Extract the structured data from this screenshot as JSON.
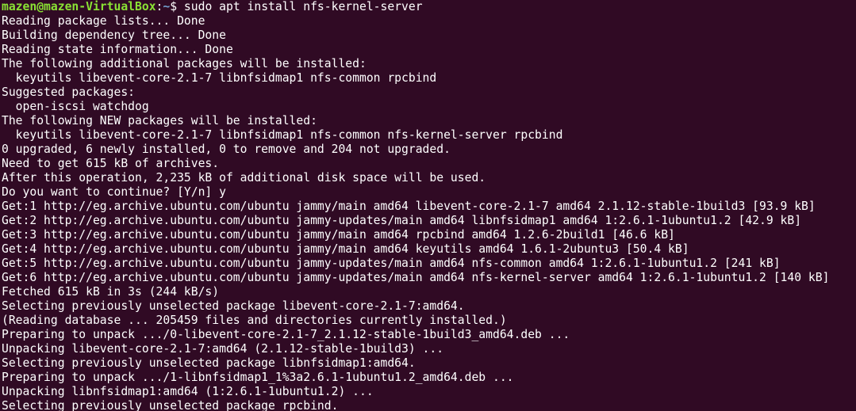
{
  "colors": {
    "background": "#300a24",
    "text": "#ffffff",
    "prompt_user": "#8ae234",
    "prompt_path": "#729fcf"
  },
  "prompt": {
    "user_host": "mazen@mazen-VirtualBox",
    "separator": ":",
    "path": "~",
    "symbol": "$ ",
    "command": "sudo apt install nfs-kernel-server"
  },
  "output_lines": [
    "Reading package lists... Done",
    "Building dependency tree... Done",
    "Reading state information... Done",
    "The following additional packages will be installed:",
    "  keyutils libevent-core-2.1-7 libnfsidmap1 nfs-common rpcbind",
    "Suggested packages:",
    "  open-iscsi watchdog",
    "The following NEW packages will be installed:",
    "  keyutils libevent-core-2.1-7 libnfsidmap1 nfs-common nfs-kernel-server rpcbind",
    "0 upgraded, 6 newly installed, 0 to remove and 204 not upgraded.",
    "Need to get 615 kB of archives.",
    "After this operation, 2,235 kB of additional disk space will be used.",
    "Do you want to continue? [Y/n] y",
    "Get:1 http://eg.archive.ubuntu.com/ubuntu jammy/main amd64 libevent-core-2.1-7 amd64 2.1.12-stable-1build3 [93.9 kB]",
    "Get:2 http://eg.archive.ubuntu.com/ubuntu jammy-updates/main amd64 libnfsidmap1 amd64 1:2.6.1-1ubuntu1.2 [42.9 kB]",
    "Get:3 http://eg.archive.ubuntu.com/ubuntu jammy/main amd64 rpcbind amd64 1.2.6-2build1 [46.6 kB]",
    "Get:4 http://eg.archive.ubuntu.com/ubuntu jammy/main amd64 keyutils amd64 1.6.1-2ubuntu3 [50.4 kB]",
    "Get:5 http://eg.archive.ubuntu.com/ubuntu jammy-updates/main amd64 nfs-common amd64 1:2.6.1-1ubuntu1.2 [241 kB]",
    "Get:6 http://eg.archive.ubuntu.com/ubuntu jammy-updates/main amd64 nfs-kernel-server amd64 1:2.6.1-1ubuntu1.2 [140 kB]",
    "Fetched 615 kB in 3s (244 kB/s)",
    "Selecting previously unselected package libevent-core-2.1-7:amd64.",
    "(Reading database ... 205459 files and directories currently installed.)",
    "Preparing to unpack .../0-libevent-core-2.1-7_2.1.12-stable-1build3_amd64.deb ...",
    "Unpacking libevent-core-2.1-7:amd64 (2.1.12-stable-1build3) ...",
    "Selecting previously unselected package libnfsidmap1:amd64.",
    "Preparing to unpack .../1-libnfsidmap1_1%3a2.6.1-1ubuntu1.2_amd64.deb ...",
    "Unpacking libnfsidmap1:amd64 (1:2.6.1-1ubuntu1.2) ...",
    "Selecting previously unselected package rpcbind."
  ]
}
